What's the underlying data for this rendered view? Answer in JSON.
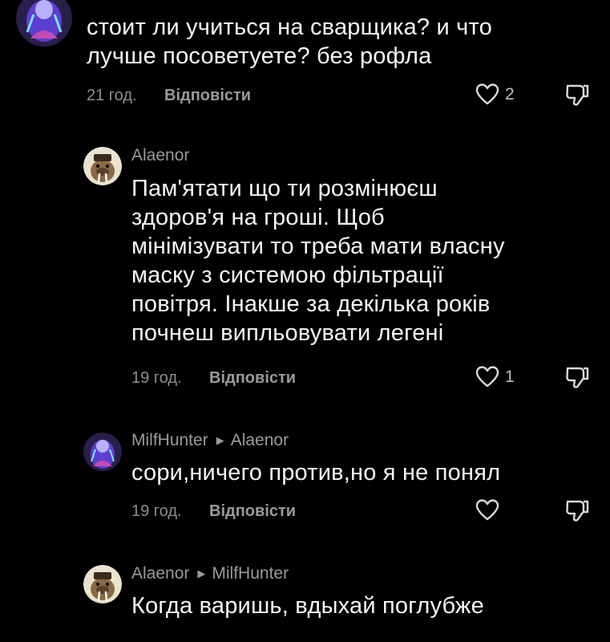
{
  "comments": [
    {
      "author": "",
      "text_lines": [
        "стоит ли учиться на сварщика? и что",
        "лучше посоветуете? без рофла"
      ],
      "time": "21 год.",
      "reply_label": "Відповісти",
      "likes": "2",
      "avatar_icon": "purple-figure-avatar"
    },
    {
      "author": "Alaenor",
      "text_lines": [
        "Пам'ятати що ти розмінюєш",
        "здоров'я на гроші. Щоб",
        "мінімізувати то треба мати власну",
        "маску з системою фільтрації",
        "повітря. Інакше за декілька років",
        "почнеш випльовувати легені"
      ],
      "time": "19 год.",
      "reply_label": "Відповісти",
      "likes": "1",
      "avatar_icon": "walrus-avatar"
    },
    {
      "author": "MilfHunter",
      "reply_to": "Alaenor",
      "text_lines": [
        "сори,ничего против,но я не понял"
      ],
      "time": "19 год.",
      "reply_label": "Відповісти",
      "likes": "",
      "avatar_icon": "purple-figure-avatar"
    },
    {
      "author": "Alaenor",
      "reply_to": "MilfHunter",
      "text_lines": [
        "Когда варишь, вдыхай поглубже"
      ],
      "time": "",
      "reply_label": "",
      "likes": "",
      "avatar_icon": "walrus-avatar"
    }
  ],
  "icons": {
    "like": "heart-outline-icon",
    "dislike": "thumb-down-outline-icon",
    "reply_arrow": "triangle-right-icon"
  },
  "colors": {
    "background": "#000000",
    "text": "#f5f5f5",
    "muted": "#9a9a9a",
    "avatar_purple": "#6a4cc7",
    "avatar_walrus_bg": "#e9e2cf"
  }
}
